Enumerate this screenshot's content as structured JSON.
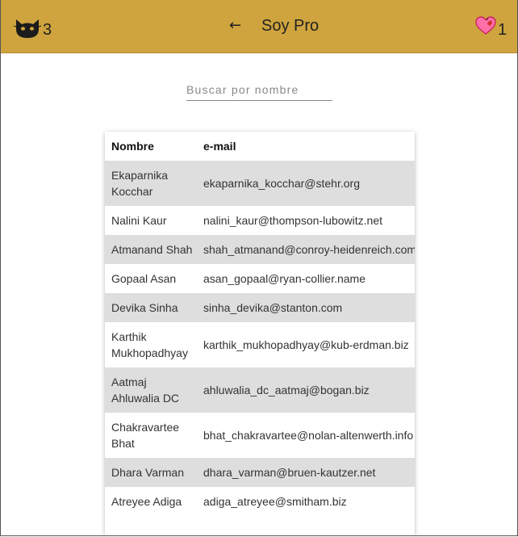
{
  "header": {
    "cat_count": "3",
    "back_label": "←",
    "title": "Soy Pro",
    "heart_count": "1",
    "bg_color": "#cfa43e"
  },
  "search": {
    "placeholder": "Buscar por nombre",
    "value": ""
  },
  "table": {
    "columns": [
      "Nombre",
      "e-mail"
    ],
    "rows": [
      {
        "name": "Ekaparnika Kocchar",
        "email": "ekaparnika_kocchar@stehr.org"
      },
      {
        "name": "Nalini Kaur",
        "email": "nalini_kaur@thompson-lubowitz.net"
      },
      {
        "name": "Atmanand Shah",
        "email": "shah_atmanand@conroy-heidenreich.com"
      },
      {
        "name": "Gopaal Asan",
        "email": "asan_gopaal@ryan-collier.name"
      },
      {
        "name": "Devika Sinha",
        "email": "sinha_devika@stanton.com"
      },
      {
        "name": "Karthik Mukhopadhyay",
        "email": "karthik_mukhopadhyay@kub-erdman.biz"
      },
      {
        "name": "Aatmaj Ahluwalia DC",
        "email": "ahluwalia_dc_aatmaj@bogan.biz"
      },
      {
        "name": "Chakravartee Bhat",
        "email": "bhat_chakravartee@nolan-altenwerth.info"
      },
      {
        "name": "Dhara Varman",
        "email": "dhara_varman@bruen-kautzer.net"
      },
      {
        "name": "Atreyee Adiga",
        "email": "adiga_atreyee@smitham.biz"
      }
    ]
  }
}
